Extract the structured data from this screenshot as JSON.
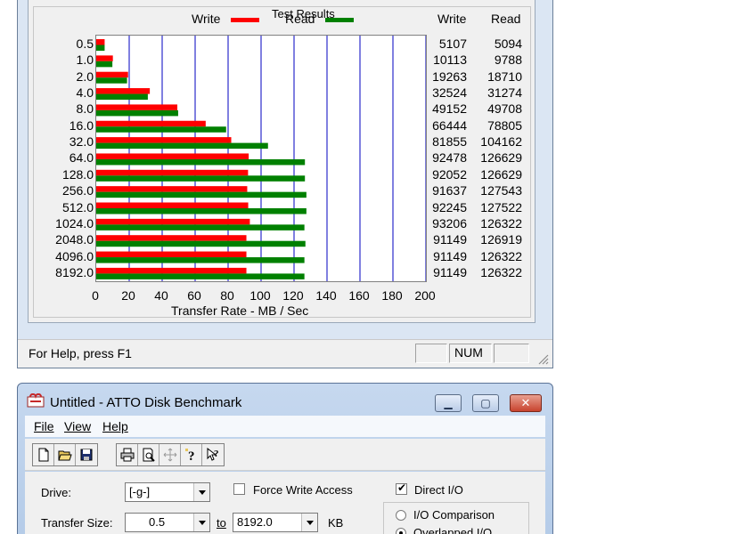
{
  "results": {
    "group_title": "Test Results",
    "legend": [
      {
        "label": "Write",
        "color": "#ff0000"
      },
      {
        "label": "Read",
        "color": "#008000"
      }
    ],
    "columns": {
      "write": "Write",
      "read": "Read"
    },
    "rows": [
      {
        "size": "0.5",
        "write": "5107",
        "read": "5094"
      },
      {
        "size": "1.0",
        "write": "10113",
        "read": "9788"
      },
      {
        "size": "2.0",
        "write": "19263",
        "read": "18710"
      },
      {
        "size": "4.0",
        "write": "32524",
        "read": "31274"
      },
      {
        "size": "8.0",
        "write": "49152",
        "read": "49708"
      },
      {
        "size": "16.0",
        "write": "66444",
        "read": "78805"
      },
      {
        "size": "32.0",
        "write": "81855",
        "read": "104162"
      },
      {
        "size": "64.0",
        "write": "92478",
        "read": "126629"
      },
      {
        "size": "128.0",
        "write": "92052",
        "read": "126629"
      },
      {
        "size": "256.0",
        "write": "91637",
        "read": "127543"
      },
      {
        "size": "512.0",
        "write": "92245",
        "read": "127522"
      },
      {
        "size": "1024.0",
        "write": "93206",
        "read": "126322"
      },
      {
        "size": "2048.0",
        "write": "91149",
        "read": "126919"
      },
      {
        "size": "4096.0",
        "write": "91149",
        "read": "126322"
      },
      {
        "size": "8192.0",
        "write": "91149",
        "read": "126322"
      }
    ]
  },
  "chart_data": {
    "type": "bar",
    "orientation": "horizontal",
    "categories": [
      "0.5",
      "1.0",
      "2.0",
      "4.0",
      "8.0",
      "16.0",
      "32.0",
      "64.0",
      "128.0",
      "256.0",
      "512.0",
      "1024.0",
      "2048.0",
      "4096.0",
      "8192.0"
    ],
    "series": [
      {
        "name": "Write",
        "color": "#ff0000",
        "values": [
          5.1,
          10.1,
          19.3,
          32.5,
          49.2,
          66.4,
          81.9,
          92.5,
          92.1,
          91.6,
          92.2,
          93.2,
          91.1,
          91.1,
          91.1
        ]
      },
      {
        "name": "Read",
        "color": "#008000",
        "values": [
          5.1,
          9.8,
          18.7,
          31.3,
          49.7,
          78.8,
          104.2,
          126.6,
          126.6,
          127.5,
          127.5,
          126.3,
          126.9,
          126.3,
          126.3
        ]
      }
    ],
    "xlabel": "Transfer Rate - MB / Sec",
    "xticks": [
      "0",
      "20",
      "40",
      "60",
      "80",
      "100",
      "120",
      "140",
      "160",
      "180",
      "200"
    ],
    "xlim": [
      0,
      200
    ],
    "grid": true,
    "legend_position": "top"
  },
  "statusbar": {
    "help_text": "For Help, press F1",
    "num": "NUM"
  },
  "app": {
    "title": "Untitled - ATTO Disk Benchmark",
    "menu": [
      {
        "label": "File"
      },
      {
        "label": "View"
      },
      {
        "label": "Help"
      }
    ],
    "toolbar_icons": [
      "new-icon",
      "open-icon",
      "save-icon",
      "print-icon",
      "print-preview-icon",
      "move-icon",
      "about-icon",
      "context-help-icon"
    ]
  },
  "form": {
    "drive_label": "Drive:",
    "drive_value": "[-g-]",
    "force_write_label": "Force Write Access",
    "force_write_checked": false,
    "direct_io_label": "Direct I/O",
    "direct_io_checked": true,
    "transfer_size_label": "Transfer Size:",
    "transfer_from": "0.5",
    "to_label": "to",
    "transfer_to": "8192.0",
    "unit": "KB",
    "io_comparison_label": "I/O Comparison",
    "overlapped_label": "Overlapped I/O"
  }
}
